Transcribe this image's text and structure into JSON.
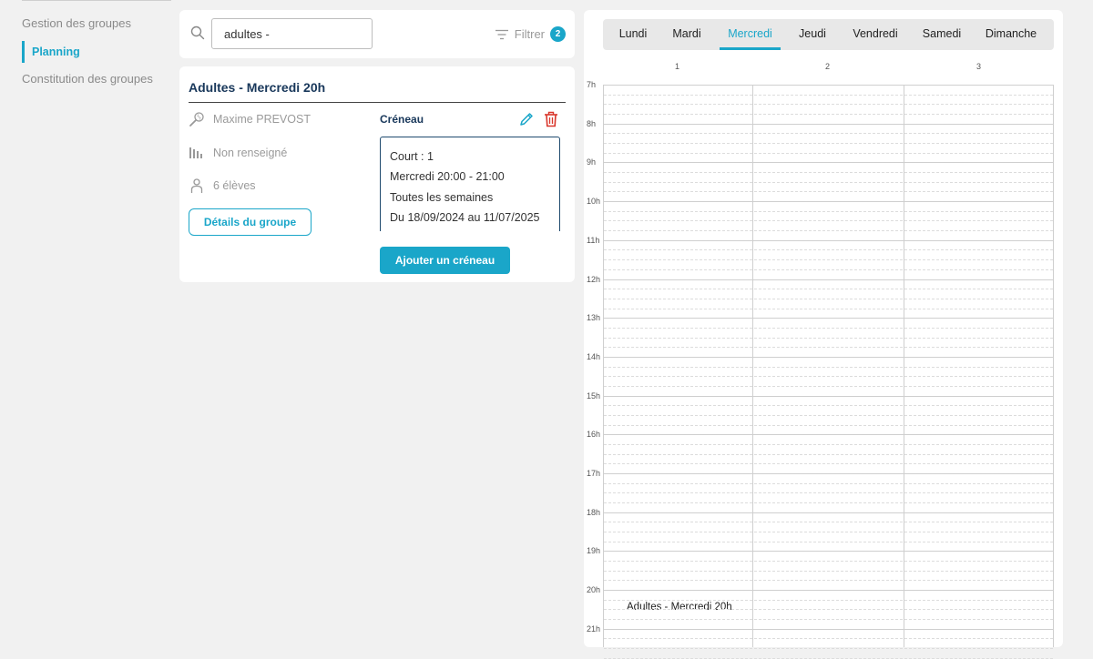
{
  "nav": {
    "items": [
      {
        "label": "Gestion des groupes",
        "active": false
      },
      {
        "label": "Planning",
        "active": true
      },
      {
        "label": "Constitution des groupes",
        "active": false
      }
    ]
  },
  "search": {
    "value": "adultes -",
    "filter_label": "Filtrer",
    "filter_count": "2"
  },
  "group": {
    "title": "Adultes - Mercredi 20h",
    "coach": "Maxime PREVOST",
    "level": "Non renseigné",
    "students": "6 élèves",
    "details_label": "Détails du groupe",
    "creneau_label": "Créneau",
    "slot": {
      "court": "Court : 1",
      "time": "Mercredi 20:00 - 21:00",
      "frequency": "Toutes les semaines",
      "period": "Du 18/09/2024 au 11/07/2025"
    },
    "add_label": "Ajouter un créneau"
  },
  "calendar": {
    "days": [
      "Lundi",
      "Mardi",
      "Mercredi",
      "Jeudi",
      "Vendredi",
      "Samedi",
      "Dimanche"
    ],
    "active_day": "Mercredi",
    "columns": [
      "1",
      "2",
      "3"
    ],
    "hours": [
      "7h",
      "8h",
      "9h",
      "10h",
      "11h",
      "12h",
      "13h",
      "14h",
      "15h",
      "16h",
      "17h",
      "18h",
      "19h",
      "20h",
      "21h"
    ],
    "event": {
      "label": "Adultes - Mercredi 20h",
      "column": "1",
      "start": "20:00",
      "end": "21:00"
    }
  },
  "colors": {
    "accent": "#1aa6c9",
    "title": "#18375a",
    "danger": "#d9362b"
  }
}
